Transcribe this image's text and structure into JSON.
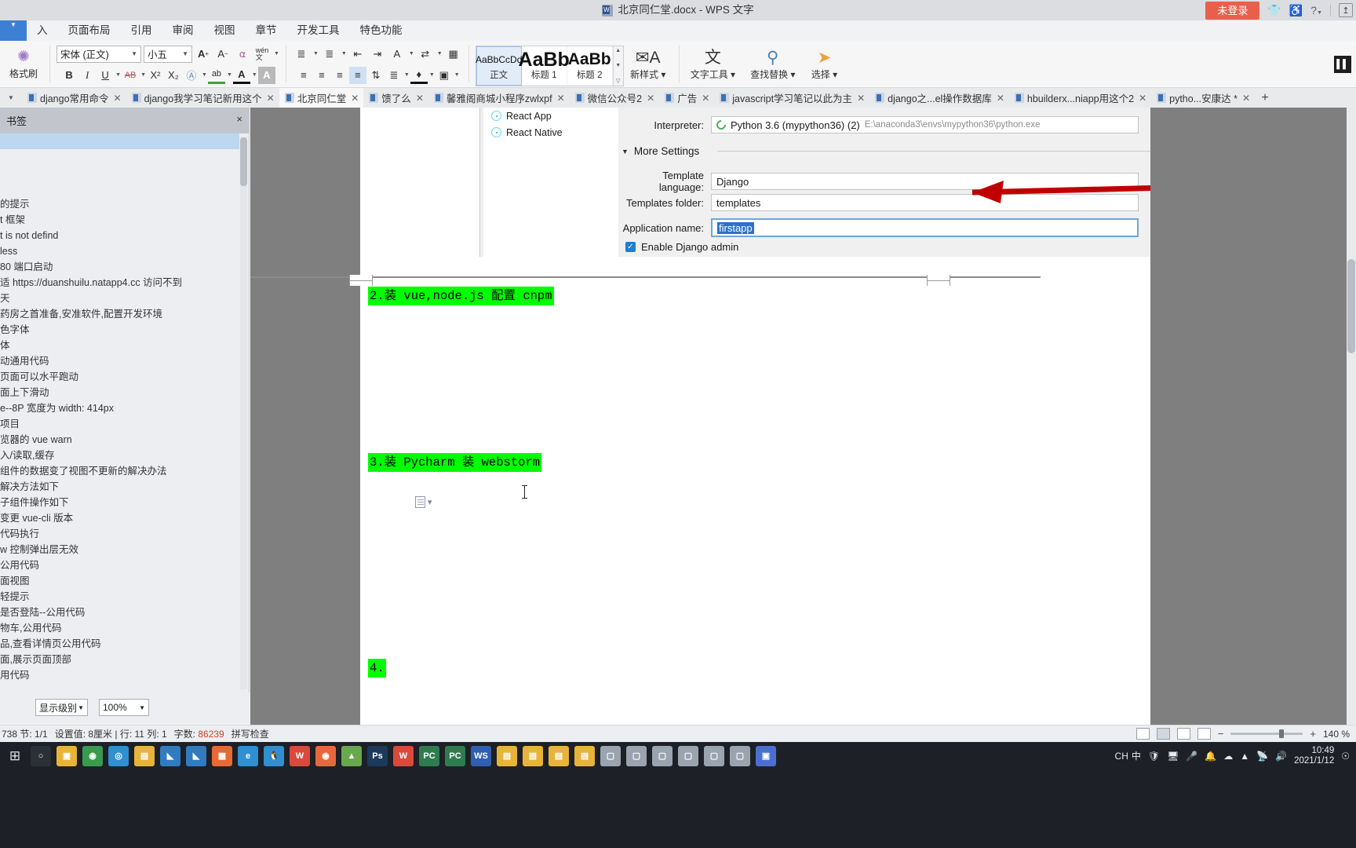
{
  "titlebar": {
    "doc_title": "北京同仁堂.docx - WPS 文字",
    "login_label": "未登录",
    "icons": [
      "shirt-icon",
      "wechat-icon",
      "help-icon"
    ],
    "help_label": "?",
    "share_label": "↥"
  },
  "menubar": {
    "items": [
      "入",
      "页面布局",
      "引用",
      "审阅",
      "视图",
      "章节",
      "开发工具",
      "特色功能"
    ]
  },
  "ribbon": {
    "format_painter": "格式刷",
    "font_name": "宋体 (正文)",
    "font_size": "小五",
    "grow_font": "A",
    "shrink_font": "A",
    "clear_format": "Ⱥ",
    "pinyin": "wén",
    "bold": "B",
    "italic": "I",
    "underline": "U",
    "strike": "AB",
    "superscript": "X²",
    "subscript": "X₂",
    "char_border": "Ⓐ",
    "highlight": "ab",
    "font_color": "A",
    "shading": "A",
    "bullets": "≔",
    "numbering": "⅓",
    "dec_indent": "⇤",
    "inc_indent": "⇥",
    "char_space": "A",
    "line_space": "↕",
    "align_left": "≡",
    "align_center": "≡",
    "align_right": "≡",
    "align_justify": "≡",
    "distribute": "⊞",
    "paragraph_space": "⇕",
    "shade_fill": "◆",
    "borders": "⊞",
    "styles": [
      {
        "preview": "AaBbCcDd",
        "label": "正文",
        "selected": true
      },
      {
        "preview": "AaBb",
        "label": "标题 1",
        "selected": false
      },
      {
        "preview": "AaBb",
        "label": "标题 2",
        "selected": false
      }
    ],
    "new_style": "新样式",
    "text_tools": "文字工具",
    "find_replace": "查找替换",
    "select": "选择"
  },
  "doctabs": [
    {
      "label": "django常用命令",
      "active": false
    },
    {
      "label": "django我学习笔记新用这个",
      "active": false
    },
    {
      "label": "北京同仁堂",
      "active": true
    },
    {
      "label": "馈了么",
      "active": false
    },
    {
      "label": "馨雅阁商城小程序zwlxpf",
      "active": false
    },
    {
      "label": "微信公众号2",
      "active": false
    },
    {
      "label": "广告",
      "active": false
    },
    {
      "label": "javascript学习笔记以此为主",
      "active": false
    },
    {
      "label": "django之...el操作数据库",
      "active": false
    },
    {
      "label": "hbuilderx...niapp用这个2",
      "active": false
    },
    {
      "label": "pytho...安康达 *",
      "active": false
    }
  ],
  "tab_add": "+",
  "leftpane": {
    "header": "书签",
    "close": "×",
    "items": [
      {
        "text": "",
        "selected": true
      },
      {
        "text": ""
      },
      {
        "text": ""
      },
      {
        "text": ""
      },
      {
        "text": "的提示"
      },
      {
        "text": "t 框架"
      },
      {
        "text": "t is not defind"
      },
      {
        "text": " less"
      },
      {
        "text": " 80 端口启动"
      },
      {
        "text": "适 https://duanshuilu.natapp4.cc 访问不到"
      },
      {
        "text": "天"
      },
      {
        "text": "药房之首准备,安准软件,配置开发环境"
      },
      {
        "text": "色字体"
      },
      {
        "text": "体"
      },
      {
        "text": "动通用代码"
      },
      {
        "text": "页面可以水平跑动"
      },
      {
        "text": "面上下滑动"
      },
      {
        "text": "e--8P 宽度为 width: 414px"
      },
      {
        "text": "项目"
      },
      {
        "text": "览器的 vue warn"
      },
      {
        "text": "入/读取,缓存"
      },
      {
        "text": "组件的数据变了视图不更新的解决办法"
      },
      {
        "text": "解决方法如下"
      },
      {
        "text": "子组件操作如下"
      },
      {
        "text": "变更 vue-cli 版本"
      },
      {
        "text": "代码执行"
      },
      {
        "text": "w 控制弹出层无效"
      },
      {
        "text": "公用代码"
      },
      {
        "text": "面视图"
      },
      {
        "text": "轻提示"
      },
      {
        "text": "是否登陆--公用代码"
      },
      {
        "text": "物车,公用代码"
      },
      {
        "text": "品,查看详情页公用代码"
      },
      {
        "text": "面,展示页面顶部"
      },
      {
        "text": "用代码"
      }
    ],
    "footer": {
      "level_label": "显示级别",
      "zoom_label": "100%"
    }
  },
  "screenshot": {
    "tree": [
      {
        "label": "React App",
        "icon": "react-icon"
      },
      {
        "label": "React Native",
        "icon": "react-icon"
      }
    ],
    "interpreter_label": "Interpreter:",
    "interpreter_value": "Python 3.6 (mypython36) (2)",
    "interpreter_path": "E:\\anaconda3\\envs\\mypython36\\python.exe",
    "more_settings": "More Settings",
    "template_language_label": "Template language:",
    "template_language_value": "Django",
    "templates_folder_label": "Templates folder:",
    "templates_folder_value": "templates",
    "application_name_label": "Application name:",
    "application_name_value": "firstapp",
    "enable_admin_label": "Enable Django admin",
    "enable_admin_checked": true,
    "arrow_color": "#c00000"
  },
  "document": {
    "lines": [
      {
        "text": "2.装 vue,node.js    配置 cnpm",
        "highlight": "#00ff00"
      },
      {
        "text": "3.装 Pycharm           装 webstorm",
        "highlight": "#00ff00"
      },
      {
        "text": "4.",
        "highlight": "#00ff00"
      }
    ]
  },
  "statusbar": {
    "page_info": "738  节: 1/1",
    "position": "设置值: 8厘米 | 行: 11  列: 1",
    "wordcount_label": "字数:",
    "wordcount_value": "86239",
    "spellcheck": "拼写检查",
    "zoom_percent": "140 %",
    "zoom_minus": "−",
    "zoom_plus": "+"
  },
  "taskbar": {
    "start": "⊞",
    "apps": [
      {
        "name": "search-icon",
        "glyph": "○",
        "color": "#2b2f36"
      },
      {
        "name": "explorer-icon",
        "glyph": "▣",
        "color": "#e8b339"
      },
      {
        "name": "chrome-icon",
        "glyph": "◉",
        "color": "#3a9a4e"
      },
      {
        "name": "edge-icon",
        "glyph": "◎",
        "color": "#2f8fd0"
      },
      {
        "name": "folder-icon",
        "glyph": "▤",
        "color": "#e8b339"
      },
      {
        "name": "vscode-icon",
        "glyph": "◣",
        "color": "#2f7cc0"
      },
      {
        "name": "vscode2-icon",
        "glyph": "◣",
        "color": "#2f7cc0"
      },
      {
        "name": "grid-icon",
        "glyph": "▦",
        "color": "#e86a33"
      },
      {
        "name": "ie-icon",
        "glyph": "e",
        "color": "#2f8fd0"
      },
      {
        "name": "qq-icon",
        "glyph": "🐧",
        "color": "#2f8fd0"
      },
      {
        "name": "wps-icon",
        "glyph": "W",
        "color": "#d94a3d"
      },
      {
        "name": "firefox-icon",
        "glyph": "◉",
        "color": "#e8683d"
      },
      {
        "name": "android-icon",
        "glyph": "▲",
        "color": "#6aa84f"
      },
      {
        "name": "ps-icon",
        "glyph": "Ps",
        "color": "#1b3a5c"
      },
      {
        "name": "wps2-icon",
        "glyph": "W",
        "color": "#d94a3d"
      },
      {
        "name": "pycharm-icon",
        "glyph": "PC",
        "color": "#2f7c4f"
      },
      {
        "name": "pycharm2-icon",
        "glyph": "PC",
        "color": "#2f7c4f"
      },
      {
        "name": "webstorm-icon",
        "glyph": "WS",
        "color": "#2f5fb0"
      },
      {
        "name": "folder2-icon",
        "glyph": "▤",
        "color": "#e8b339"
      },
      {
        "name": "folder3-icon",
        "glyph": "▤",
        "color": "#e8b339"
      },
      {
        "name": "folder4-icon",
        "glyph": "▤",
        "color": "#e8b339"
      },
      {
        "name": "folder5-icon",
        "glyph": "▤",
        "color": "#e8b339"
      },
      {
        "name": "window-icon",
        "glyph": "▢",
        "color": "#9aa4b0"
      },
      {
        "name": "window2-icon",
        "glyph": "▢",
        "color": "#9aa4b0"
      },
      {
        "name": "window3-icon",
        "glyph": "▢",
        "color": "#9aa4b0"
      },
      {
        "name": "window4-icon",
        "glyph": "▢",
        "color": "#9aa4b0"
      },
      {
        "name": "window5-icon",
        "glyph": "▢",
        "color": "#9aa4b0"
      },
      {
        "name": "window6-icon",
        "glyph": "▢",
        "color": "#9aa4b0"
      },
      {
        "name": "teams-icon",
        "glyph": "▣",
        "color": "#4a6fd0"
      }
    ],
    "tray": {
      "ime": "CH",
      "ime_mode": "中",
      "icons": [
        "shield-icon",
        "monitor-icon",
        "battery-icon",
        "mic-icon",
        "bell-icon",
        "cloud-icon",
        "chevron-icon",
        "network-icon",
        "volume-icon",
        "sync-icon"
      ],
      "time": "10:49",
      "date": "2021/1/12"
    }
  }
}
